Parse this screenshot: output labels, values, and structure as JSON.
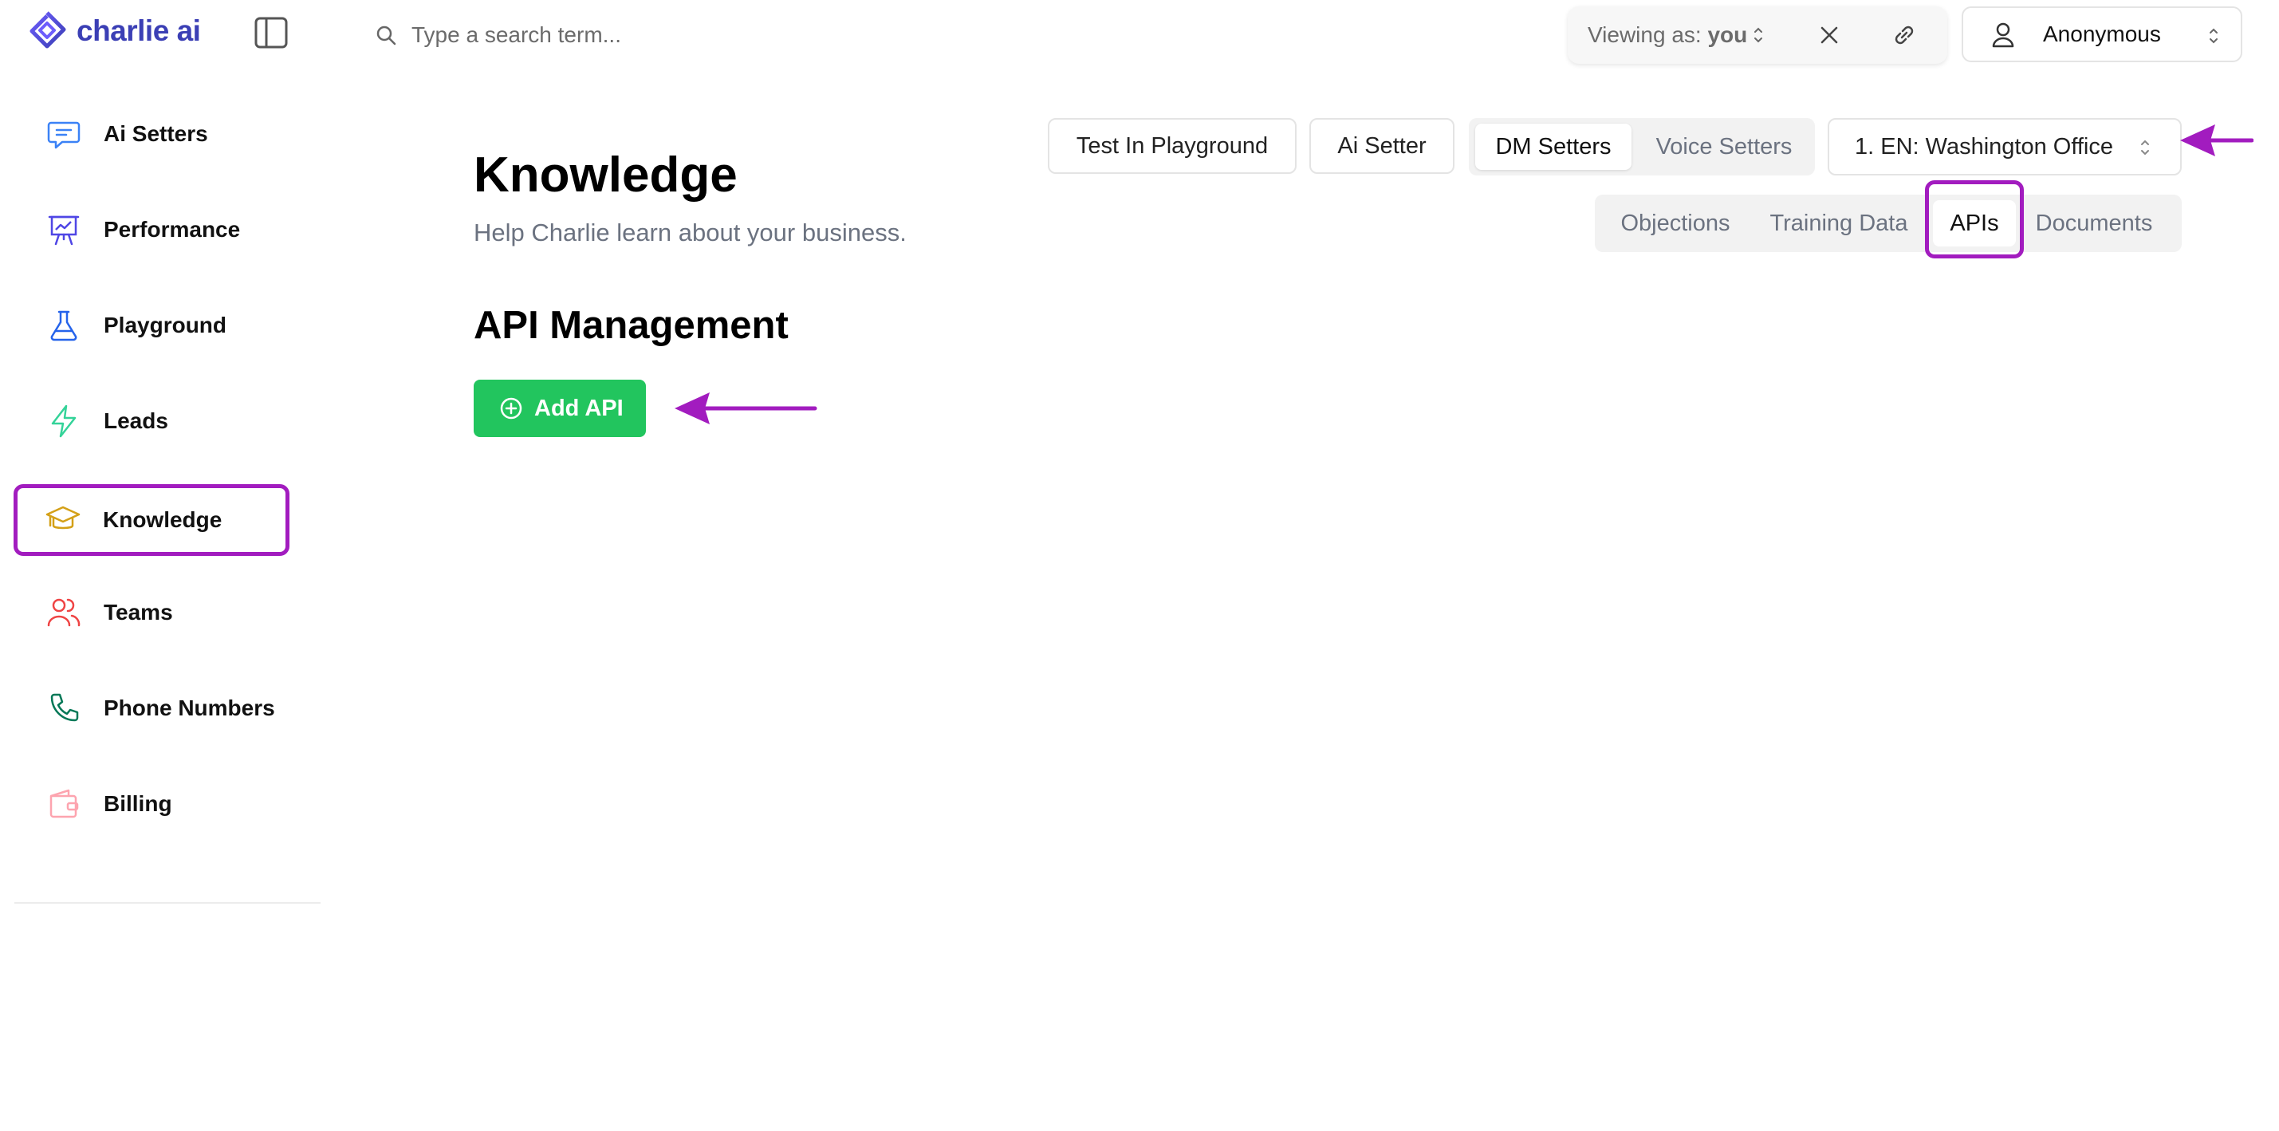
{
  "brand": {
    "name": "charlie ai"
  },
  "search": {
    "placeholder": "Type a search term..."
  },
  "viewing": {
    "prefix": "Viewing as:",
    "value": "you"
  },
  "account": {
    "name": "Anonymous"
  },
  "sidebar": {
    "items": [
      {
        "label": "Ai Setters",
        "icon": "chat-icon",
        "color": "#3b82f6"
      },
      {
        "label": "Performance",
        "icon": "presentation-chart-icon",
        "color": "#4f46e5"
      },
      {
        "label": "Playground",
        "icon": "flask-icon",
        "color": "#2563eb"
      },
      {
        "label": "Leads",
        "icon": "lightning-icon",
        "color": "#34d399"
      },
      {
        "label": "Knowledge",
        "icon": "graduation-cap-icon",
        "color": "#d4a017",
        "active": true
      },
      {
        "label": "Teams",
        "icon": "users-icon",
        "color": "#ef4444"
      },
      {
        "label": "Phone Numbers",
        "icon": "phone-icon",
        "color": "#047857"
      },
      {
        "label": "Billing",
        "icon": "wallet-icon",
        "color": "#fda4af"
      }
    ]
  },
  "header": {
    "title": "Knowledge",
    "subtitle": "Help Charlie learn about your business.",
    "test_playground_label": "Test In Playground",
    "ai_setter_label": "Ai Setter",
    "setter_types": [
      {
        "label": "DM Setters",
        "selected": true
      },
      {
        "label": "Voice Setters",
        "selected": false
      }
    ],
    "office_select": "1. EN: Washington Office",
    "tabs": [
      {
        "label": "Objections",
        "selected": false
      },
      {
        "label": "Training Data",
        "selected": false
      },
      {
        "label": "APIs",
        "selected": true
      },
      {
        "label": "Documents",
        "selected": false
      }
    ]
  },
  "main": {
    "section_title": "API Management",
    "add_button_label": "Add API"
  },
  "colors": {
    "highlight": "#a21cbf",
    "add_button": "#22c55e",
    "brand": "#3b3fb5"
  }
}
